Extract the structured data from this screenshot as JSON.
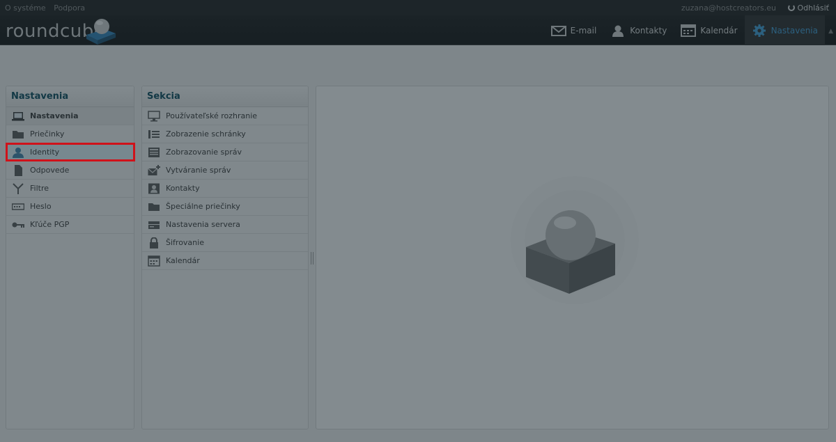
{
  "topline": {
    "about": "O systéme",
    "support": "Podpora",
    "user": "zuzana@hostcreators.eu",
    "logout": "Odhlásiť"
  },
  "logo": {
    "text": "roundcube"
  },
  "nav": [
    {
      "label": "E-mail",
      "icon": "mail-icon"
    },
    {
      "label": "Kontakty",
      "icon": "contacts-icon"
    },
    {
      "label": "Kalendár",
      "icon": "calendar-icon"
    },
    {
      "label": "Nastavenia",
      "icon": "gear-icon",
      "active": true
    }
  ],
  "settings_panel": {
    "title": "Nastavenia",
    "items": [
      {
        "label": "Nastavenia",
        "icon": "laptop-icon"
      },
      {
        "label": "Priečinky",
        "icon": "folder-icon"
      },
      {
        "label": "Identity",
        "icon": "person-icon"
      },
      {
        "label": "Odpovede",
        "icon": "document-icon"
      },
      {
        "label": "Filtre",
        "icon": "filter-icon"
      },
      {
        "label": "Heslo",
        "icon": "password-icon"
      },
      {
        "label": "Kľúče PGP",
        "icon": "key-icon"
      }
    ]
  },
  "section_panel": {
    "title": "Sekcia",
    "items": [
      {
        "label": "Používateľské rozhranie",
        "icon": "monitor-icon"
      },
      {
        "label": "Zobrazenie schránky",
        "icon": "mailbox-list-icon"
      },
      {
        "label": "Zobrazovanie správ",
        "icon": "message-view-icon"
      },
      {
        "label": "Vytváranie správ",
        "icon": "compose-icon"
      },
      {
        "label": "Kontakty",
        "icon": "contact-card-icon"
      },
      {
        "label": "Špeciálne priečinky",
        "icon": "folder-icon"
      },
      {
        "label": "Nastavenia servera",
        "icon": "server-icon"
      },
      {
        "label": "Šifrovanie",
        "icon": "lock-icon"
      },
      {
        "label": "Kalendár",
        "icon": "calendar-icon"
      }
    ]
  },
  "colors": {
    "accent": "#3a9bd8",
    "title": "#004458",
    "highlight": "#d0121a",
    "overlay": "#213036"
  }
}
